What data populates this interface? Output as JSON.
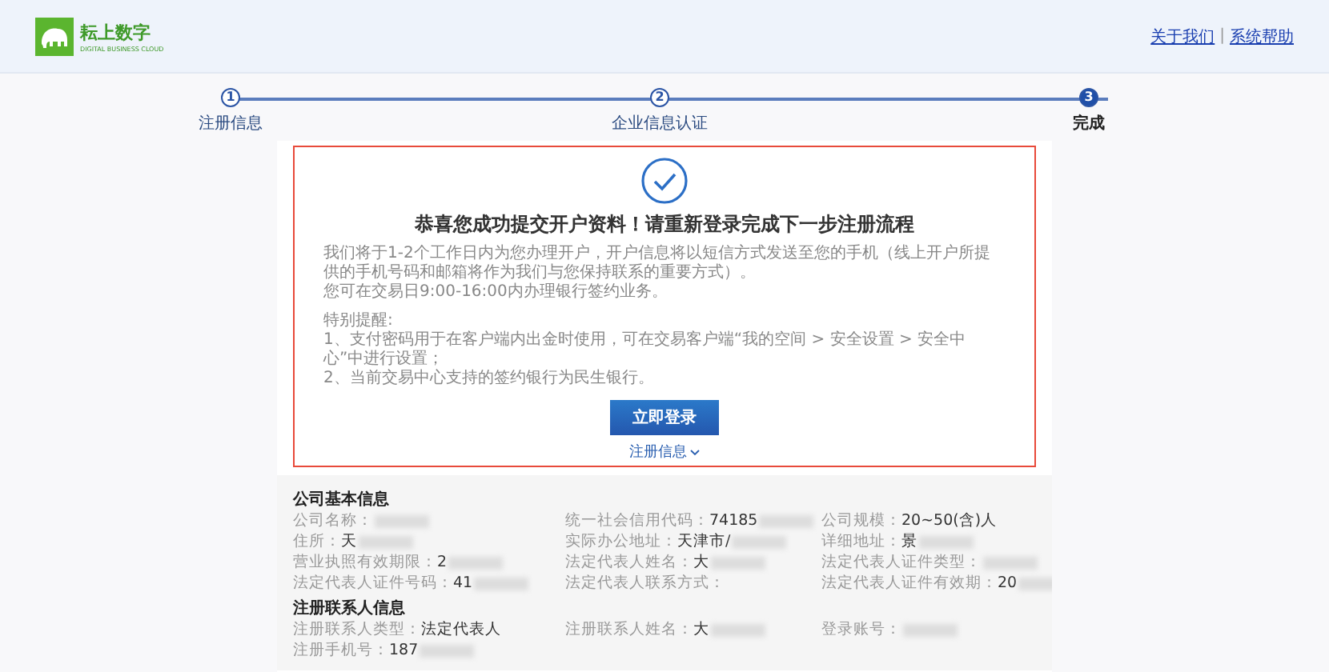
{
  "header": {
    "logo_text": "耘上数字",
    "logo_subtitle": "DIGITAL BUSINESS CLOUD",
    "links": [
      "关于我们",
      "系统帮助"
    ],
    "separator": "|"
  },
  "steps": [
    {
      "number": "1",
      "label": "注册信息",
      "selected": false
    },
    {
      "number": "2",
      "label": "企业信息认证",
      "selected": false
    },
    {
      "number": "3",
      "label": "完成",
      "selected": true
    }
  ],
  "result": {
    "title": "恭喜您成功提交开户资料！请重新登录完成下一步注册流程",
    "paragraphs": [
      "我们将于1-2个工作日内为您办理开户，开户信息将以短信方式发送至您的手机（线上开户所提供的手机号码和邮箱将作为我们与您保持联系的重要方式）。",
      "您可在交易日9:00-16:00内办理银行签约业务。"
    ],
    "tips_title": "特别提醒:",
    "tips": [
      "1、支付密码用于在客户端内出金时使用，可在交易客户端“我的空间 > 安全设置 > 安全中心”中进行设置；",
      "2、当前交易中心支持的签约银行为民生银行。"
    ],
    "button": "立即登录",
    "toggle": "注册信息"
  },
  "sections": [
    {
      "title": "公司基本信息",
      "fields": [
        {
          "label": "公司名称：",
          "blurred": true
        },
        {
          "label": "统一社会信用代码：",
          "value": "74185",
          "blurred": true
        },
        {
          "label": "公司规模：",
          "value": "20~50(含)人",
          "blurred": false
        },
        {
          "label": "住所：",
          "value": "天",
          "blurred": true
        },
        {
          "label": "实际办公地址：",
          "value": "天津市/",
          "blurred": true
        },
        {
          "label": "详细地址：",
          "value": "景",
          "blurred": true
        },
        {
          "label": "营业执照有效期限：",
          "value": "2",
          "blurred": true
        },
        {
          "label": "法定代表人姓名：",
          "value": "大",
          "blurred": true
        },
        {
          "label": "法定代表人证件类型：",
          "blurred": true
        },
        {
          "label": "法定代表人证件号码：",
          "value": "41",
          "blurred": true
        },
        {
          "label": "法定代表人联系方式：",
          "blurred": false
        },
        {
          "label": "法定代表人证件有效期：",
          "value": "20",
          "blurred": true
        }
      ]
    },
    {
      "title": "注册联系人信息",
      "fields": [
        {
          "label": "注册联系人类型：",
          "value": "法定代表人",
          "blurred": false
        },
        {
          "label": "注册联系人姓名：",
          "value": "大",
          "blurred": true
        },
        {
          "label": "登录账号：",
          "blurred": true
        },
        {
          "label": "注册手机号：",
          "value": "187",
          "blurred": true
        }
      ]
    }
  ]
}
